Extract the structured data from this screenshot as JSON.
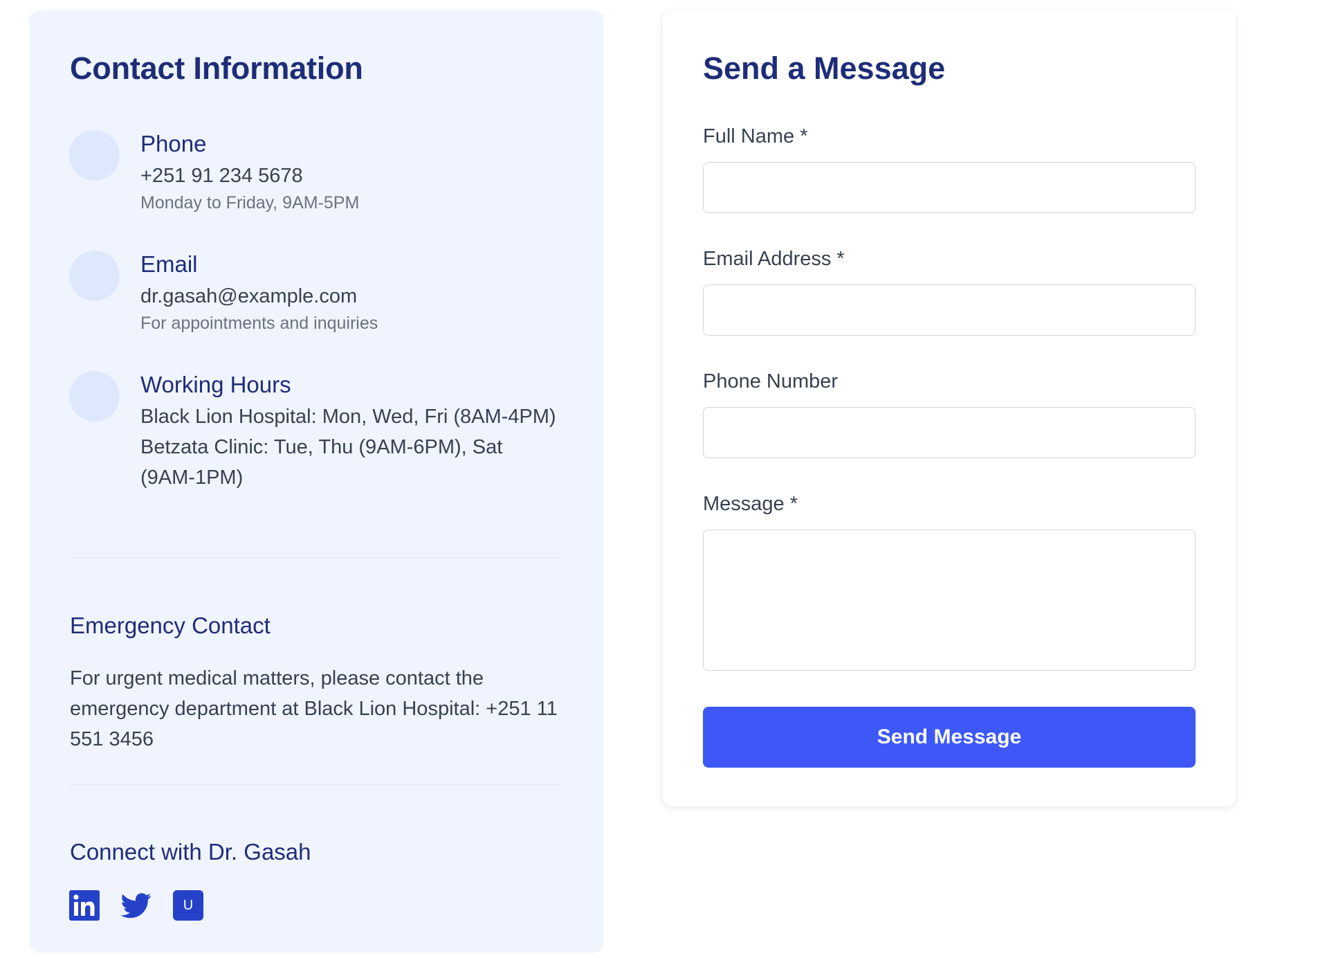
{
  "contact": {
    "title": "Contact Information",
    "items": [
      {
        "label": "Phone",
        "lines": [
          "+251 91 234 5678"
        ],
        "sub": "Monday to Friday, 9AM-5PM",
        "icon": "phone-icon"
      },
      {
        "label": "Email",
        "lines": [
          "dr.gasah@example.com"
        ],
        "sub": "For appointments and inquiries",
        "icon": "email-icon"
      },
      {
        "label": "Working Hours",
        "lines": [
          "Black Lion Hospital: Mon, Wed, Fri (8AM-4PM)",
          "Betzata Clinic: Tue, Thu (9AM-6PM), Sat (9AM-1PM)"
        ],
        "sub": "",
        "icon": "clock-icon"
      }
    ],
    "emergency": {
      "heading": "Emergency Contact",
      "text": "For urgent medical matters, please contact the emergency department at Black Lion Hospital: +251 11 551 3456"
    },
    "social": {
      "heading": "Connect with Dr. Gasah",
      "links": [
        {
          "icon": "linkedin-icon"
        },
        {
          "icon": "twitter-icon"
        },
        {
          "icon": "upwork-icon",
          "glyph": "U"
        }
      ]
    }
  },
  "form": {
    "title": "Send a Message",
    "fields": {
      "full_name": {
        "label": "Full Name *",
        "value": ""
      },
      "email": {
        "label": "Email Address *",
        "value": ""
      },
      "phone": {
        "label": "Phone Number",
        "value": ""
      },
      "message": {
        "label": "Message *",
        "value": ""
      }
    },
    "submit_label": "Send Message"
  },
  "colors": {
    "accent": "#3d58f6",
    "heading": "#1e2d78",
    "card_bg": "#f0f4fe",
    "icon_circle": "#dde8fc",
    "social": "#2541c9"
  }
}
